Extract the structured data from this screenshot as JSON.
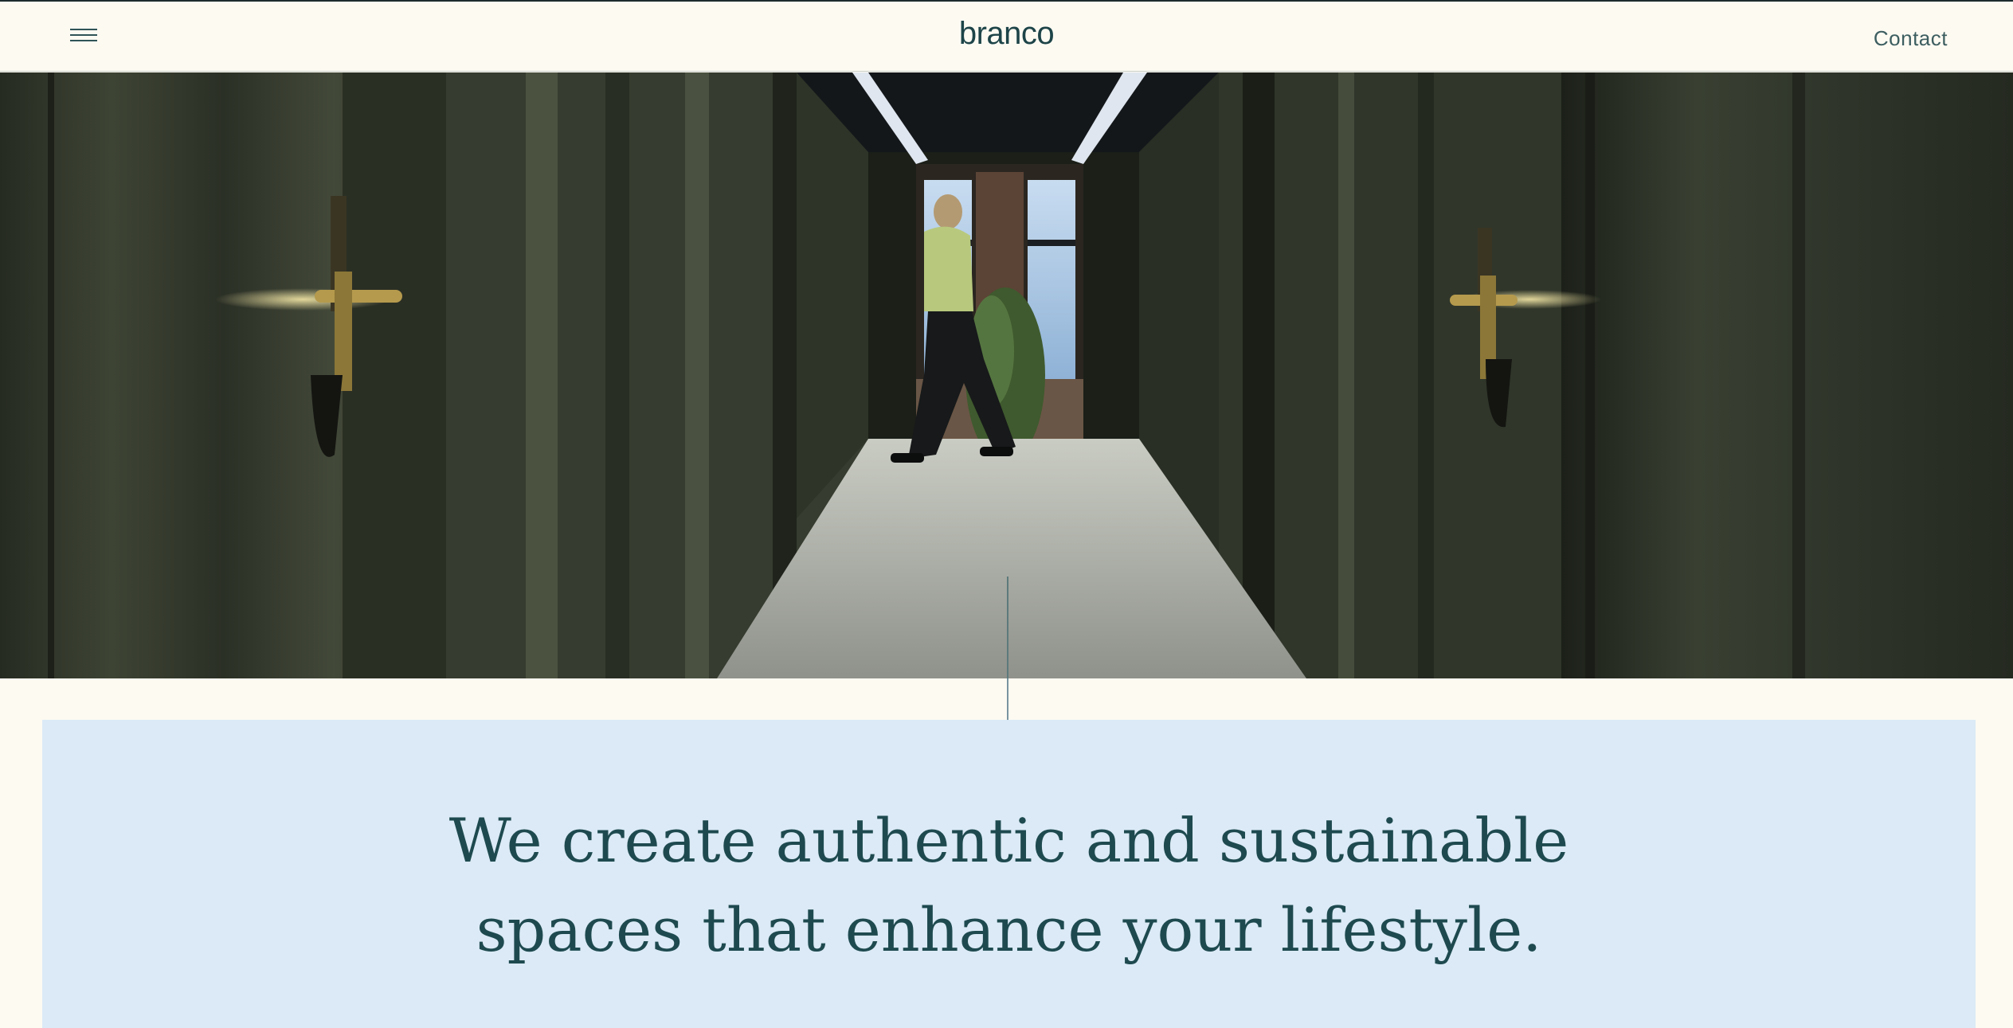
{
  "header": {
    "menu_icon": "hamburger-menu-icon",
    "logo": "branco",
    "contact_label": "Contact"
  },
  "hero": {
    "scroll_icon": "scroll-down-arrow-icon"
  },
  "intro": {
    "line_1": "We create authentic and sustainable",
    "line_2": "spaces that enhance your lifestyle."
  },
  "colors": {
    "page_background": "#fdfaf2",
    "panel_background": "#dbeaf6",
    "text_primary": "#1e4a4f"
  }
}
